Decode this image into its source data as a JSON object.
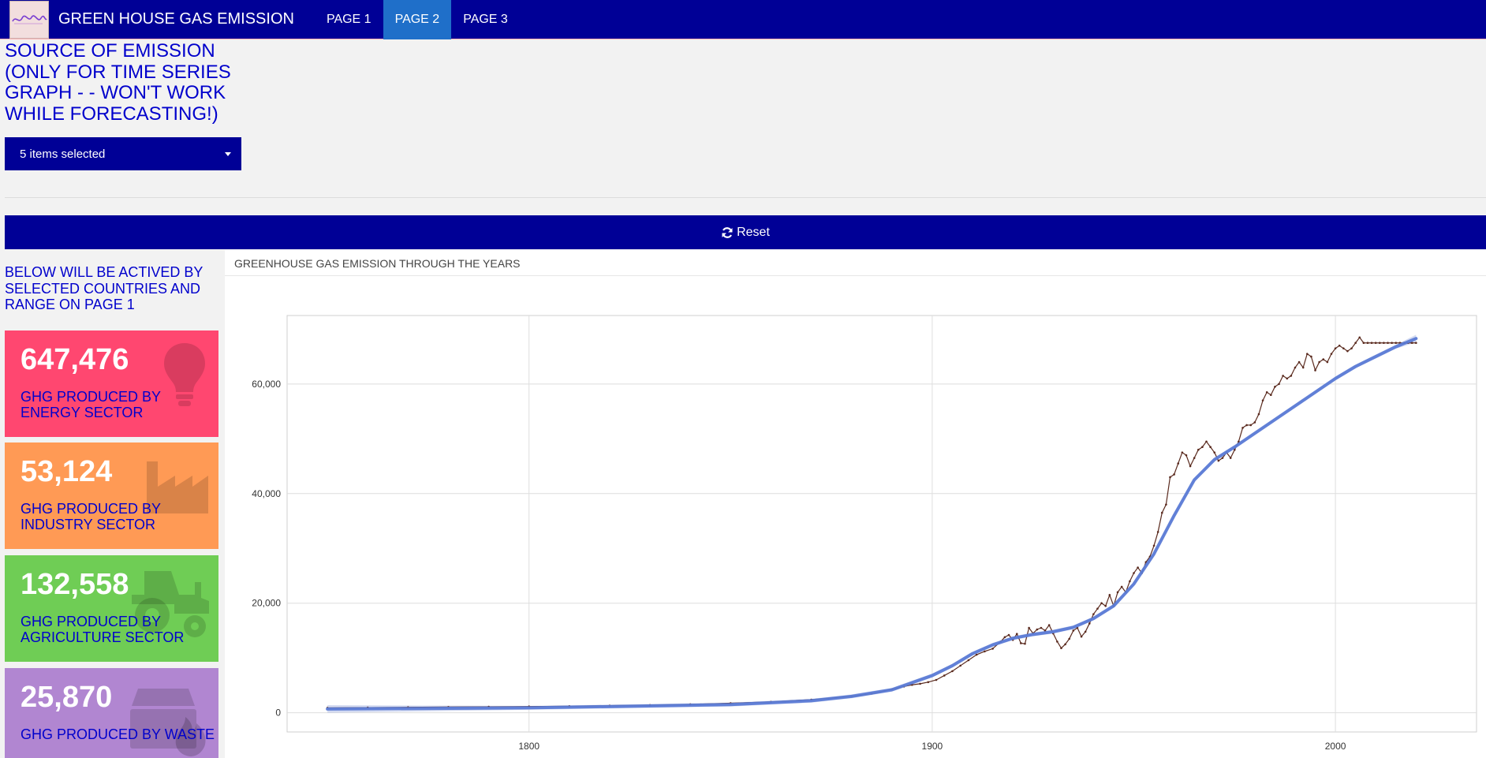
{
  "navbar": {
    "logo_alt": "logo",
    "brand": "GREEN HOUSE GAS EMISSION",
    "tabs": [
      "PAGE 1",
      "PAGE 2",
      "PAGE 3"
    ],
    "active_tab": "PAGE 2"
  },
  "sidebar": {
    "title": "SOURCE OF EMISSION (ONLY FOR TIME SERIES GRAPH - - WON'T WORK WHILE FORECASTING!)",
    "picker_value": "5 items selected",
    "note": "BELOW WILL BE ACTIVED BY SELECTED COUNTRIES AND RANGE ON PAGE 1"
  },
  "reset_label": "Reset",
  "value_boxes": [
    {
      "value": "647,476",
      "label": "GHG PRODUCED BY ENERGY SECTOR",
      "icon": "lightbulb-icon",
      "color": "#ff4770"
    },
    {
      "value": "53,124",
      "label": "GHG PRODUCED BY INDUSTRY SECTOR",
      "icon": "industry-icon",
      "color": "#ff9a55"
    },
    {
      "value": "132,558",
      "label": "GHG PRODUCED BY AGRICULTURE SECTOR",
      "icon": "tractor-icon",
      "color": "#6fcd55"
    },
    {
      "value": "25,870",
      "label": "GHG PRODUCED BY WASTE",
      "icon": "dumpster-fire-icon",
      "color": "#b186d1"
    }
  ],
  "panel_title": "GREENHOUSE GAS EMISSION THROUGH THE YEARS",
  "chart_data": {
    "type": "line",
    "title": "",
    "xlabel": "",
    "ylabel": "",
    "xlim": [
      1740,
      2035
    ],
    "ylim": [
      -3500,
      72500
    ],
    "xticks": [
      1800,
      1900,
      2000
    ],
    "xtick_labels": [
      "1800",
      "1900",
      "2000"
    ],
    "yticks": [
      0,
      20000,
      40000,
      60000
    ],
    "ytick_labels": [
      "0",
      "20,000",
      "40,000",
      "60,000"
    ],
    "grid": true,
    "colors": {
      "observed": "#5a2a1e",
      "trend": "#5b7bd5",
      "band": "#b8c3e8"
    },
    "series": [
      {
        "name": "",
        "style": "observed",
        "x": [
          1750,
          1760,
          1770,
          1780,
          1790,
          1800,
          1810,
          1820,
          1830,
          1840,
          1850,
          1860,
          1870,
          1880,
          1885,
          1890,
          1893,
          1895,
          1897,
          1899,
          1901,
          1903,
          1905,
          1907,
          1909,
          1911,
          1913,
          1915,
          1917,
          1918,
          1919,
          1920,
          1921,
          1922,
          1923,
          1924,
          1925,
          1926,
          1927,
          1928,
          1929,
          1930,
          1931,
          1932,
          1933,
          1934,
          1935,
          1936,
          1937,
          1938,
          1939,
          1940,
          1941,
          1942,
          1943,
          1944,
          1945,
          1946,
          1947,
          1948,
          1949,
          1950,
          1951,
          1952,
          1953,
          1954,
          1955,
          1956,
          1957,
          1958,
          1959,
          1960,
          1961,
          1962,
          1963,
          1964,
          1965,
          1966,
          1967,
          1968,
          1969,
          1970,
          1971,
          1972,
          1973,
          1974,
          1975,
          1976,
          1977,
          1978,
          1979,
          1980,
          1981,
          1982,
          1983,
          1984,
          1985,
          1986,
          1987,
          1988,
          1989,
          1990,
          1991,
          1992,
          1993,
          1994,
          1995,
          1996,
          1997,
          1998,
          1999,
          2000,
          2001,
          2002,
          2003,
          2004,
          2005,
          2006,
          2007,
          2008,
          2009,
          2010,
          2011,
          2012,
          2013,
          2014,
          2015,
          2016,
          2017,
          2018,
          2019,
          2020
        ],
        "y": [
          900,
          950,
          1000,
          1050,
          1100,
          1150,
          1200,
          1300,
          1400,
          1550,
          1750,
          2000,
          2400,
          3000,
          3500,
          4300,
          4800,
          5100,
          5300,
          5600,
          6000,
          6800,
          7600,
          8600,
          9600,
          10600,
          11200,
          11700,
          13000,
          13800,
          14200,
          13300,
          14400,
          12700,
          12600,
          15500,
          14500,
          15200,
          15500,
          15000,
          16000,
          14500,
          13000,
          11800,
          12500,
          13500,
          15000,
          15500,
          13900,
          14800,
          16300,
          18000,
          19000,
          20000,
          19500,
          21500,
          19500,
          22000,
          23000,
          22000,
          24000,
          25500,
          26500,
          25500,
          27500,
          28500,
          30500,
          33000,
          36500,
          38000,
          43000,
          43500,
          45500,
          47500,
          47000,
          45000,
          46500,
          48000,
          48500,
          49500,
          48500,
          47500,
          46000,
          46500,
          47500,
          46500,
          48000,
          49500,
          52000,
          52500,
          52500,
          53000,
          54500,
          57000,
          58500,
          58000,
          59500,
          60000,
          61500,
          61000,
          61500,
          63000,
          64000,
          63000,
          65500,
          65000,
          62500,
          64000,
          64500,
          64000,
          65500,
          66500,
          67000,
          66500,
          66000,
          66500,
          67500,
          68500,
          67500,
          67500,
          67500,
          67500,
          67500,
          67500,
          67500,
          67500,
          67500,
          67500,
          67500,
          67500,
          67500,
          67500
        ]
      },
      {
        "name": "",
        "style": "trend",
        "x": [
          1750,
          1800,
          1850,
          1870,
          1880,
          1890,
          1900,
          1905,
          1910,
          1915,
          1920,
          1925,
          1930,
          1935,
          1940,
          1945,
          1950,
          1955,
          1960,
          1965,
          1970,
          1975,
          1980,
          1985,
          1990,
          1995,
          2000,
          2005,
          2010,
          2015,
          2020
        ],
        "y": [
          700,
          900,
          1500,
          2200,
          3000,
          4200,
          6800,
          8600,
          10800,
          12400,
          13600,
          14300,
          14800,
          15600,
          17200,
          19500,
          23500,
          29000,
          36000,
          42500,
          46200,
          48500,
          51000,
          53500,
          56000,
          58500,
          61000,
          63200,
          65000,
          66800,
          68300
        ]
      }
    ]
  }
}
